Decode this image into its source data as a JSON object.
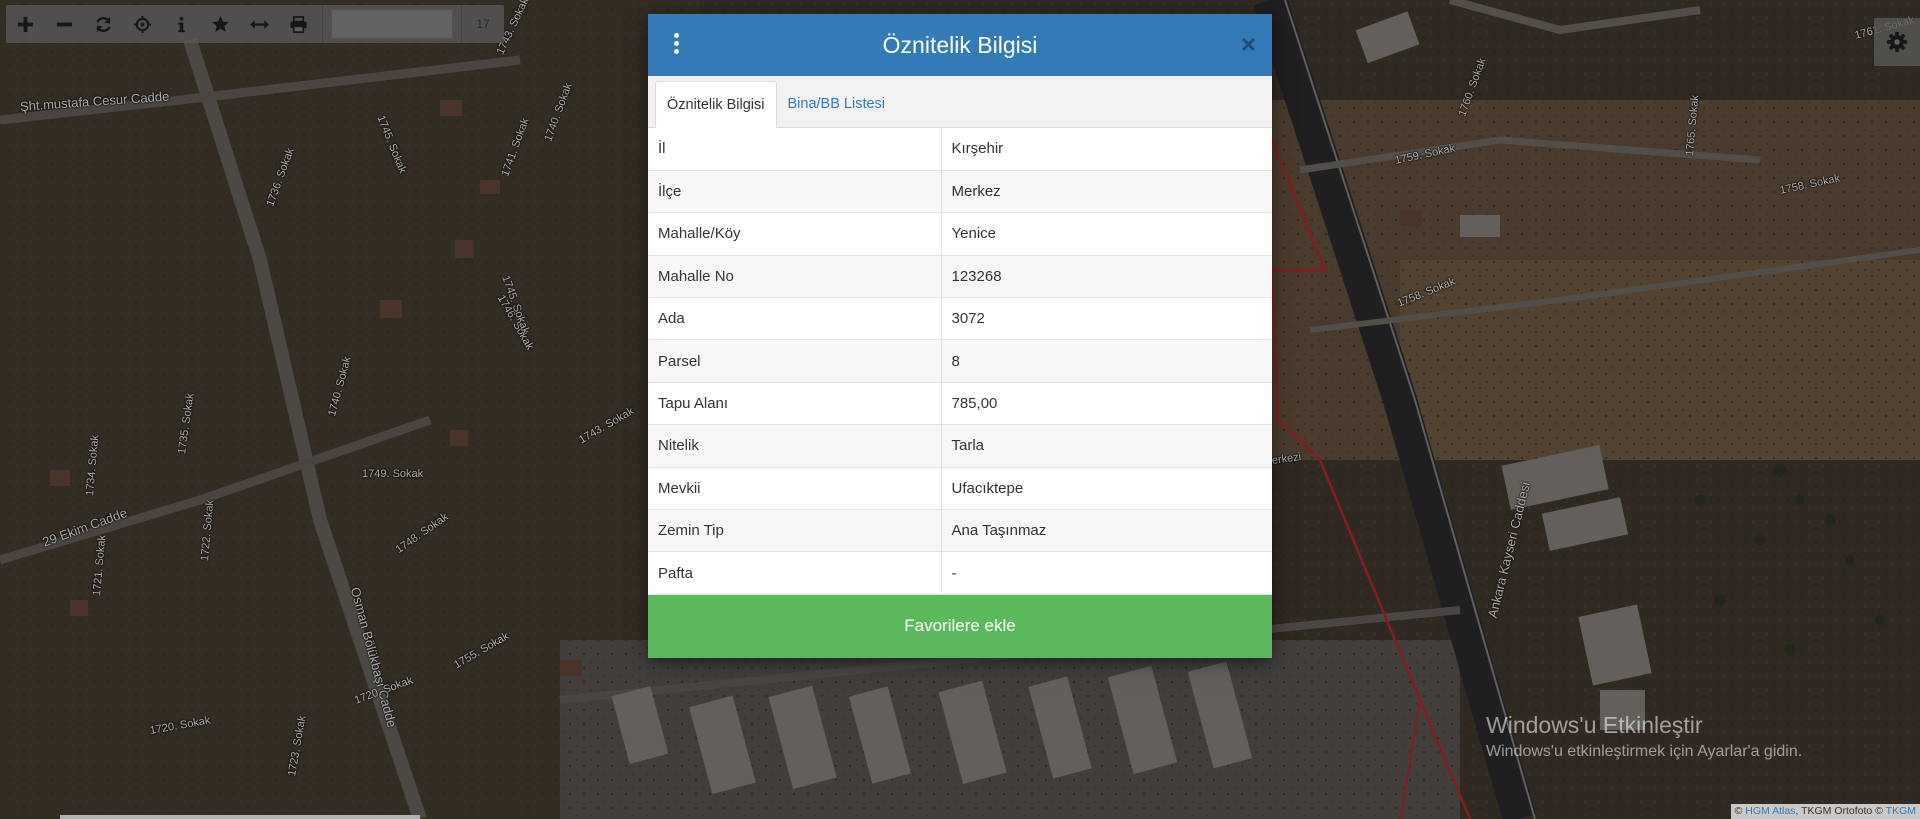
{
  "toolbar": {
    "buttons": [
      "zoom-in-icon",
      "zoom-out-icon",
      "refresh-icon",
      "locate-icon",
      "info-icon",
      "star-icon",
      "measure-icon",
      "print-icon"
    ],
    "search_value": "",
    "zoom_level": "17"
  },
  "map": {
    "road_labels": [
      "Şht.mustafa Cesur Cadde",
      "1743. Sokak",
      "1745. Sokak",
      "1741. Sokak",
      "1740. Sokak",
      "1736. Sokak",
      "1746. Sokak",
      "1745. Sokak",
      "1740. Sokak",
      "1735. Sokak",
      "1743. Sokak",
      "1734. Sokak",
      "1749. Sokak",
      "1748. Sokak",
      "1722. Sokak",
      "29 Ekim Cadde",
      "1721. Sokak",
      "Osman Bölükbaşı Cadde",
      "1755. Sokak",
      "1720. Sokak",
      "1720. Sokak",
      "1723. Sokak",
      "1759. Sokak",
      "1761. Sokak",
      "1760. Sokak",
      "1758. Sokak",
      "1765. Sokak",
      "1758. Sokak",
      "Ankara Kayseri Caddesi",
      "erkezi"
    ]
  },
  "modal": {
    "title": "Öznitelik Bilgisi",
    "close_symbol": "×",
    "tabs": [
      {
        "label": "Öznitelik Bilgisi",
        "active": true
      },
      {
        "label": "Bina/BB Listesi",
        "active": false
      }
    ],
    "rows": [
      {
        "key": "İl",
        "value": "Kırşehir"
      },
      {
        "key": "İlçe",
        "value": "Merkez"
      },
      {
        "key": "Mahalle/Köy",
        "value": "Yenice"
      },
      {
        "key": "Mahalle No",
        "value": "123268"
      },
      {
        "key": "Ada",
        "value": "3072"
      },
      {
        "key": "Parsel",
        "value": "8"
      },
      {
        "key": "Tapu Alanı",
        "value": "785,00"
      },
      {
        "key": "Nitelik",
        "value": "Tarla"
      },
      {
        "key": "Mevkii",
        "value": "Ufacıktepe"
      },
      {
        "key": "Zemin Tip",
        "value": "Ana Taşınmaz"
      },
      {
        "key": "Pafta",
        "value": "-"
      }
    ],
    "favorite_button": "Favorilere ekle"
  },
  "windows_activation": {
    "title": "Windows'u Etkinleştir",
    "subtitle": "Windows'u etkinleştirmek için Ayarlar'a gidin."
  },
  "attribution": {
    "prefix": "©",
    "hgm": "HGM Atlas",
    "middle": ", TKGM Ortofoto ©",
    "tkgm": "TKGM"
  },
  "colors": {
    "header": "#337ab7",
    "favorite": "#5cb85c",
    "parcel_boundary": "#c0292b"
  }
}
